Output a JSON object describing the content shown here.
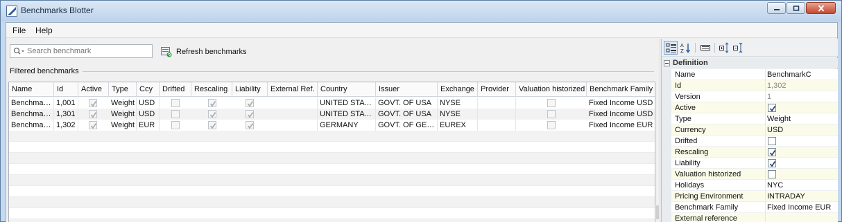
{
  "window": {
    "title": "Benchmarks Blotter"
  },
  "menu": [
    {
      "label": "File"
    },
    {
      "label": "Help"
    }
  ],
  "toolbar": {
    "search_placeholder": "Search benchmark",
    "refresh_label": "Refresh benchmarks"
  },
  "group_label": "Filtered benchmarks",
  "table": {
    "columns": [
      "Name",
      "Id",
      "Active",
      "Type",
      "Ccy",
      "Drifted",
      "Rescaling",
      "Liability",
      "External Ref.",
      "Country",
      "Issuer",
      "Exchange",
      "Provider",
      "Valuation historized",
      "Benchmark Family"
    ],
    "rows": [
      {
        "name": "BenchmarkA",
        "id": "1,001",
        "active": true,
        "type": "Weight",
        "ccy": "USD",
        "drifted": false,
        "rescaling": true,
        "liability": true,
        "external_ref": "",
        "country": "UNITED STATES",
        "issuer": "GOVT. OF USA",
        "exchange": "NYSE",
        "provider": "",
        "valuation_historized": false,
        "family": "Fixed Income USD"
      },
      {
        "name": "BenchmarkB",
        "id": "1,301",
        "active": true,
        "type": "Weight",
        "ccy": "USD",
        "drifted": false,
        "rescaling": true,
        "liability": true,
        "external_ref": "",
        "country": "UNITED STATES",
        "issuer": "GOVT. OF USA",
        "exchange": "NYSE",
        "provider": "",
        "valuation_historized": false,
        "family": "Fixed Income USD"
      },
      {
        "name": "BenchmarkC",
        "id": "1,302",
        "active": true,
        "type": "Weight",
        "ccy": "EUR",
        "drifted": false,
        "rescaling": true,
        "liability": true,
        "external_ref": "",
        "country": "GERMANY",
        "issuer": "GOVT. OF GER…",
        "exchange": "EUREX",
        "provider": "",
        "valuation_historized": false,
        "family": "Fixed Income EUR"
      }
    ]
  },
  "properties": {
    "category": "Definition",
    "items": [
      {
        "name": "Name",
        "value": "BenchmarkC",
        "kind": "text"
      },
      {
        "name": "Id",
        "value": "1,302",
        "kind": "readonly"
      },
      {
        "name": "Version",
        "value": "1",
        "kind": "readonly"
      },
      {
        "name": "Active",
        "checked": true,
        "kind": "check"
      },
      {
        "name": "Type",
        "value": "Weight",
        "kind": "text"
      },
      {
        "name": "Currency",
        "value": "USD",
        "kind": "text"
      },
      {
        "name": "Drifted",
        "checked": false,
        "kind": "check"
      },
      {
        "name": "Rescaling",
        "checked": true,
        "kind": "check"
      },
      {
        "name": "Liability",
        "checked": true,
        "kind": "check"
      },
      {
        "name": "Valuation historized",
        "checked": false,
        "kind": "check"
      },
      {
        "name": "Holidays",
        "value": "NYC",
        "kind": "text"
      },
      {
        "name": "Pricing Environment",
        "value": "INTRADAY",
        "kind": "text"
      },
      {
        "name": "Benchmark Family",
        "value": "Fixed Income EUR",
        "kind": "text"
      },
      {
        "name": "External reference",
        "value": "",
        "kind": "text"
      }
    ]
  },
  "colors": {
    "titlebar": "#c5d9ef",
    "close": "#c44a2e",
    "accent": "#7fa6cf"
  }
}
